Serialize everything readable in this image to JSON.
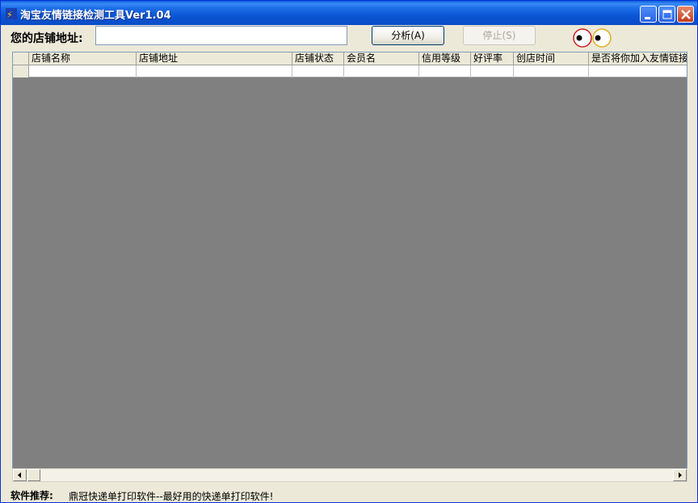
{
  "window": {
    "title": "淘宝友情链接检测工具Ver1.04",
    "app_icon": "wrench-icon",
    "controls": [
      "minimize-icon",
      "maximize-icon",
      "close-icon"
    ]
  },
  "toolbar": {
    "url_label": "您的店铺地址:",
    "url_value": "",
    "analyze_label": "分析(A)",
    "stop_label": "停止(S)"
  },
  "grid": {
    "columns": [
      "店铺名称",
      "店铺地址",
      "店铺状态",
      "会员名",
      "信用等级",
      "好评率",
      "创店时间",
      "是否将你加入友情链接"
    ],
    "rows": [
      [
        "",
        "",
        "",
        "",
        "",
        "",
        "",
        ""
      ]
    ]
  },
  "footer": {
    "label": "软件推荐:",
    "link_text": "鼎冠快递单打印软件--最好用的快递单打印软件!"
  },
  "colors": {
    "titlebar": "#0a4cc8",
    "grid_background": "#808080",
    "window_background": "#ece9d8"
  }
}
